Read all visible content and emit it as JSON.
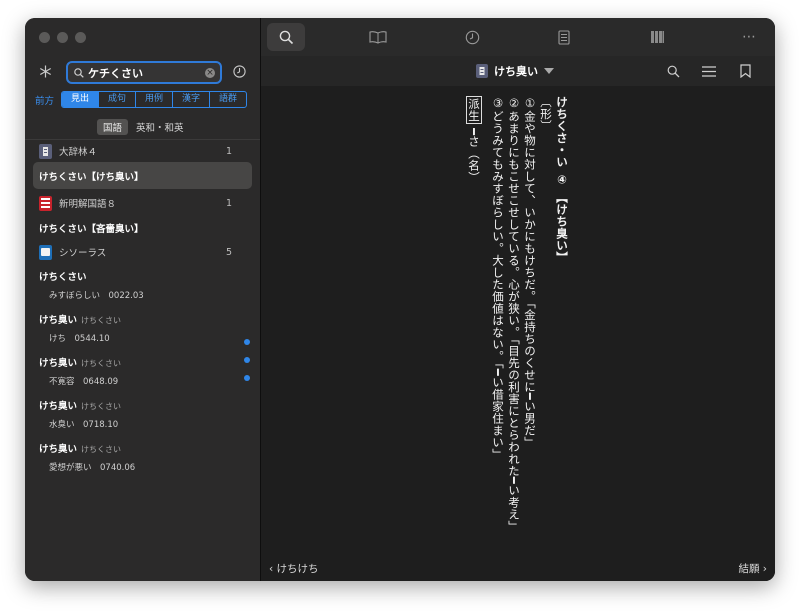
{
  "sidebar": {
    "search_query": "ケチくさい",
    "mode_label": "前方",
    "segments": [
      "見出",
      "成句",
      "用例",
      "漢字",
      "語群"
    ],
    "active_segment": 0,
    "lang": {
      "active": "国語",
      "inactive": "英和・和英"
    },
    "dictionaries": [
      {
        "name": "大辞林４",
        "count": "1",
        "color": "#5a5f7a"
      },
      {
        "name": "新明解国語８",
        "count": "1",
        "color": "#c8232c"
      },
      {
        "name": "シソーラス",
        "count": "5",
        "color": "#1e6fb8"
      }
    ],
    "entries": [
      "けちくさい【けち臭い】",
      "けちくさい【吝嗇臭い】"
    ],
    "thesaurus_results": [
      {
        "title": "けちくさい",
        "reading": "",
        "sub": "みすぼらしい　0022.03"
      },
      {
        "title": "けち臭い",
        "reading": "けちくさい",
        "sub": "けち　0544.10"
      },
      {
        "title": "けち臭い",
        "reading": "けちくさい",
        "sub": "不寛容　0648.09"
      },
      {
        "title": "けち臭い",
        "reading": "けちくさい",
        "sub": "水臭い　0718.10"
      },
      {
        "title": "けち臭い",
        "reading": "けちくさい",
        "sub": "愛想が悪い　0740.06"
      }
    ]
  },
  "toolbar": {
    "tabs": [
      "search-icon",
      "book-icon",
      "history-icon",
      "list-icon",
      "library-icon",
      "more-icon"
    ],
    "more_label": "⋯"
  },
  "header": {
    "title": "けち臭い"
  },
  "article": {
    "headword": "けちくさ・い",
    "accent": "④",
    "kanji": "【けち臭い】",
    "pos": "〔形〕",
    "line1": "①金や物に対して、いかにもけちだ。「金持ちのくせに━い男だ」",
    "line2": "②あまりにもこせこせしている。心が狭い。「目先の利害にとらわれた━い考え」",
    "line3": "③どうみてもみすぼらしい。大した価値はない。「━い借家住まい」",
    "derived_tag": "派生",
    "derived_text": "━さ（名）"
  },
  "footer": {
    "prev": "けちけち",
    "next": "結願"
  }
}
